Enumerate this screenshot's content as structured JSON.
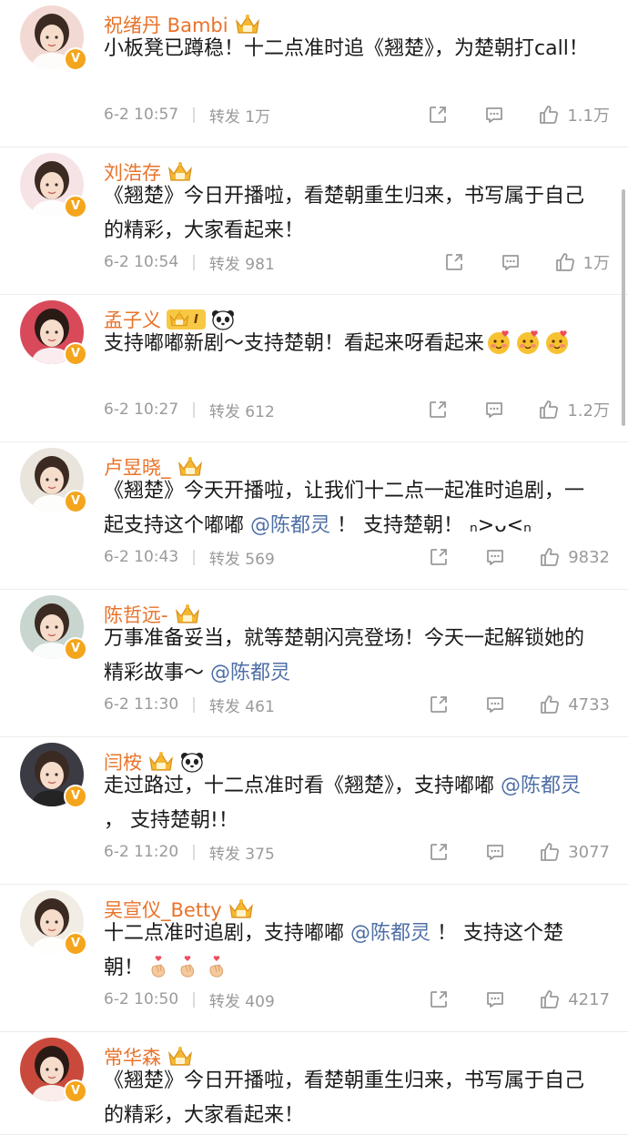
{
  "posts": [
    {
      "name": "祝绪丹 Bambi",
      "badges": [
        "crown"
      ],
      "content": [
        {
          "t": "text",
          "v": "小板凳已蹲稳！十二点准时追《翘楚》，为楚朝打call！"
        }
      ],
      "time": "6-2 10:57",
      "forward": "转发 1万",
      "likes": "1.1万",
      "avatar_color": "#f3d9d4"
    },
    {
      "name": "刘浩存",
      "badges": [
        "crown"
      ],
      "content": [
        {
          "t": "text",
          "v": "《翘楚》今日开播啦，看楚朝重生归来，书写属于自己的精彩，大家看起来！"
        }
      ],
      "time": "6-2 10:54",
      "forward": "转发 981",
      "likes": "1万",
      "avatar_color": "#f6e3e6"
    },
    {
      "name": "孟子义",
      "badges": [
        "crown-vip",
        "panda"
      ],
      "vip_text": "I",
      "content": [
        {
          "t": "text",
          "v": "支持嘟嘟新剧～支持楚朝！看起来呀看起来"
        },
        {
          "t": "emoji",
          "v": "blush-heart"
        },
        {
          "t": "emoji",
          "v": "blush-heart"
        },
        {
          "t": "emoji",
          "v": "blush-heart"
        }
      ],
      "time": "6-2 10:27",
      "forward": "转发 612",
      "likes": "1.2万",
      "avatar_color": "#d84a5a"
    },
    {
      "name": "卢昱晓_",
      "badges": [
        "crown"
      ],
      "content": [
        {
          "t": "text",
          "v": "《翘楚》今天开播啦，让我们十二点一起准时追剧，一起支持这个嘟嘟 "
        },
        {
          "t": "mention",
          "v": "@陈都灵"
        },
        {
          "t": "text",
          "v": " ！ 支持楚朝！ ₙ>ᴗ<ₙ"
        }
      ],
      "time": "6-2 10:43",
      "forward": "转发 569",
      "likes": "9832",
      "avatar_color": "#e9e4dc"
    },
    {
      "name": "陈哲远-",
      "badges": [
        "crown"
      ],
      "content": [
        {
          "t": "text",
          "v": "万事准备妥当，就等楚朝闪亮登场！今天一起解锁她的精彩故事～ "
        },
        {
          "t": "mention",
          "v": "@陈都灵"
        }
      ],
      "time": "6-2 11:30",
      "forward": "转发 461",
      "likes": "4733",
      "avatar_color": "#c9d6cf"
    },
    {
      "name": "闫桉",
      "badges": [
        "crown",
        "panda"
      ],
      "content": [
        {
          "t": "text",
          "v": "走过路过，十二点准时看《翘楚》，支持嘟嘟 "
        },
        {
          "t": "mention",
          "v": "@陈都灵"
        },
        {
          "t": "text",
          "v": " ， 支持楚朝!！"
        }
      ],
      "time": "6-2 11:20",
      "forward": "转发 375",
      "likes": "3077",
      "avatar_color": "#3b3b44"
    },
    {
      "name": "吴宣仪_Betty",
      "badges": [
        "crown"
      ],
      "content": [
        {
          "t": "text",
          "v": "十二点准时追剧，支持嘟嘟 "
        },
        {
          "t": "mention",
          "v": "@陈都灵"
        },
        {
          "t": "text",
          "v": " ！ 支持这个楚朝！"
        },
        {
          "t": "emoji",
          "v": "finger-heart"
        },
        {
          "t": "emoji",
          "v": "finger-heart"
        },
        {
          "t": "emoji",
          "v": "finger-heart"
        }
      ],
      "time": "6-2 10:50",
      "forward": "转发 409",
      "likes": "4217",
      "avatar_color": "#f1ede4"
    },
    {
      "name": "常华森",
      "badges": [
        "crown"
      ],
      "content": [
        {
          "t": "text",
          "v": "《翘楚》今日开播啦，看楚朝重生归来，书写属于自己的精彩，大家看起来！"
        }
      ],
      "time": "",
      "forward": "",
      "likes": "",
      "avatar_color": "#c94a3c"
    }
  ],
  "colors": {
    "name": "#e8732a",
    "mention": "#4e6ea6",
    "meta": "#9a9a9a",
    "verified_badge": "#f4a51c"
  }
}
